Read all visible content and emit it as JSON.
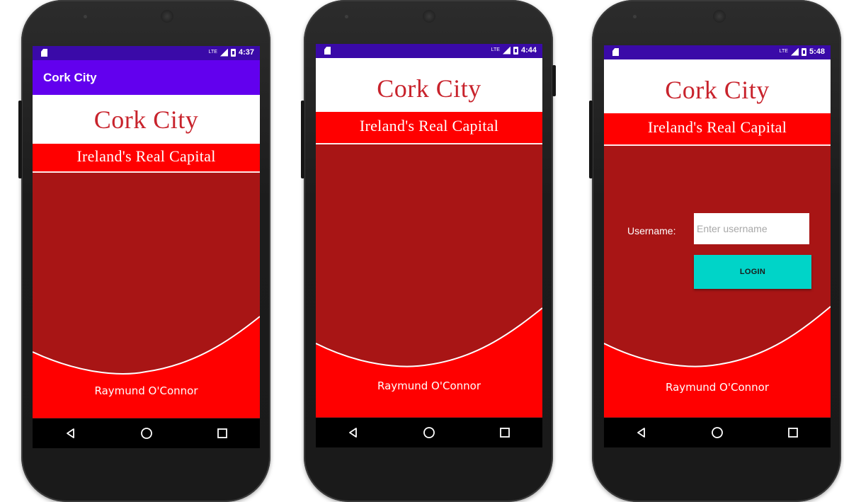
{
  "colors": {
    "app_bar": "#6200ee",
    "status_bar": "#3a0aa8",
    "header_white_bg": "#ffffff",
    "title_text": "#c8232c",
    "banner_red": "#ff0000",
    "body_dark_red": "#a81515",
    "login_button": "#00d4c8",
    "nav_bar": "#000000"
  },
  "phones": [
    {
      "status": {
        "network": "LTE",
        "time": "4:37"
      },
      "app_bar": {
        "title": "Cork City"
      },
      "header": {
        "title": "Cork City",
        "subtitle": "Ireland's Real Capital"
      },
      "footer": {
        "name": "Raymund O'Connor"
      },
      "nav": {
        "back": "back-icon",
        "home": "home-icon",
        "recents": "recents-icon"
      }
    },
    {
      "status": {
        "network": "LTE",
        "time": "4:44"
      },
      "header": {
        "title": "Cork City",
        "subtitle": "Ireland's Real Capital"
      },
      "footer": {
        "name": "Raymund O'Connor"
      },
      "nav": {
        "back": "back-icon",
        "home": "home-icon",
        "recents": "recents-icon"
      }
    },
    {
      "status": {
        "network": "LTE",
        "time": "5:48"
      },
      "header": {
        "title": "Cork City",
        "subtitle": "Ireland's Real Capital"
      },
      "login": {
        "username_label": "Username:",
        "username_value": "",
        "username_placeholder": "Enter username",
        "login_button": "LOGIN"
      },
      "footer": {
        "name": "Raymund O'Connor"
      },
      "nav": {
        "back": "back-icon",
        "home": "home-icon",
        "recents": "recents-icon"
      }
    }
  ]
}
